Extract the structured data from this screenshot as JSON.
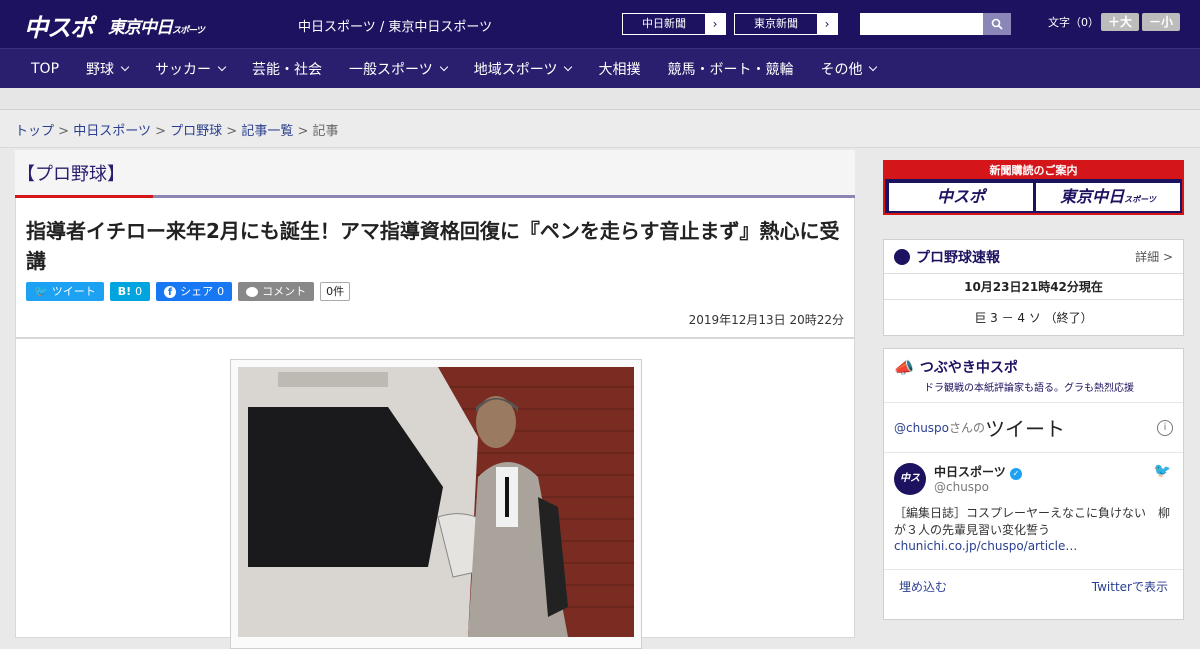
{
  "header": {
    "logo_chuspo": "中スポ",
    "logo_tokyo": "東京中日",
    "logo_tokyo_sub": "スポーツ",
    "site_links": "中日スポーツ / 東京中日スポーツ",
    "paper1": "中日新聞",
    "paper2": "東京新聞",
    "font_label": "文字（0）",
    "font_plus": "＋大",
    "font_minus": "－小"
  },
  "nav": [
    "TOP",
    "野球",
    "サッカー",
    "芸能・社会",
    "一般スポーツ",
    "地域スポーツ",
    "大相撲",
    "競馬・ボート・競輪",
    "その他"
  ],
  "nav_dropdown": [
    false,
    true,
    true,
    false,
    true,
    true,
    false,
    false,
    true
  ],
  "breadcrumb": {
    "items": [
      "トップ",
      "中日スポーツ",
      "プロ野球",
      "記事一覧"
    ],
    "current": "記事",
    "sep": ">"
  },
  "category": "【プロ野球】",
  "article": {
    "title": "指導者イチロー来年2月にも誕生！アマ指導資格回復に『ペンを走らす音止まず』熱心に受講",
    "tweet": "ツイート",
    "hatena_count": "0",
    "share_label": "シェア",
    "share_count": "0",
    "comment_label": "コメント",
    "comment_count": "0件",
    "date": "2019年12月13日 20時22分"
  },
  "sidebar": {
    "promo_title": "新聞購読のご案内",
    "promo_chuspo": "中スポ",
    "promo_tokyo": "東京中日",
    "promo_tokyo_sub": "スポーツ",
    "baseball_title": "プロ野球速報",
    "baseball_more": "詳細 >",
    "baseball_time": "10月23日21時42分現在",
    "baseball_score": "巨 3 － 4 ソ （終了）",
    "tw_title": "つぶやき中スポ",
    "tw_sub": "ドラ観戦の本紙評論家も語る。グラも熱烈応援",
    "tw_at": "@chuspo",
    "tw_san": "さんの",
    "tw_tweets": "ツイート",
    "tweet_name": "中日スポーツ",
    "tweet_handle": "@chuspo",
    "tweet_text": "［編集日誌］コスプレーヤーえなこに負けない　柳が３人の先輩見習い変化誓う",
    "tweet_link": "chunichi.co.jp/chuspo/article…",
    "embed": "埋め込む",
    "view_on": "Twitterで表示"
  },
  "colors": {
    "navy": "#1c1260",
    "nav": "#2a1f6e",
    "red": "#d4161b",
    "twitter": "#1da1f2",
    "hatena": "#00a4de",
    "facebook": "#1877f2"
  }
}
